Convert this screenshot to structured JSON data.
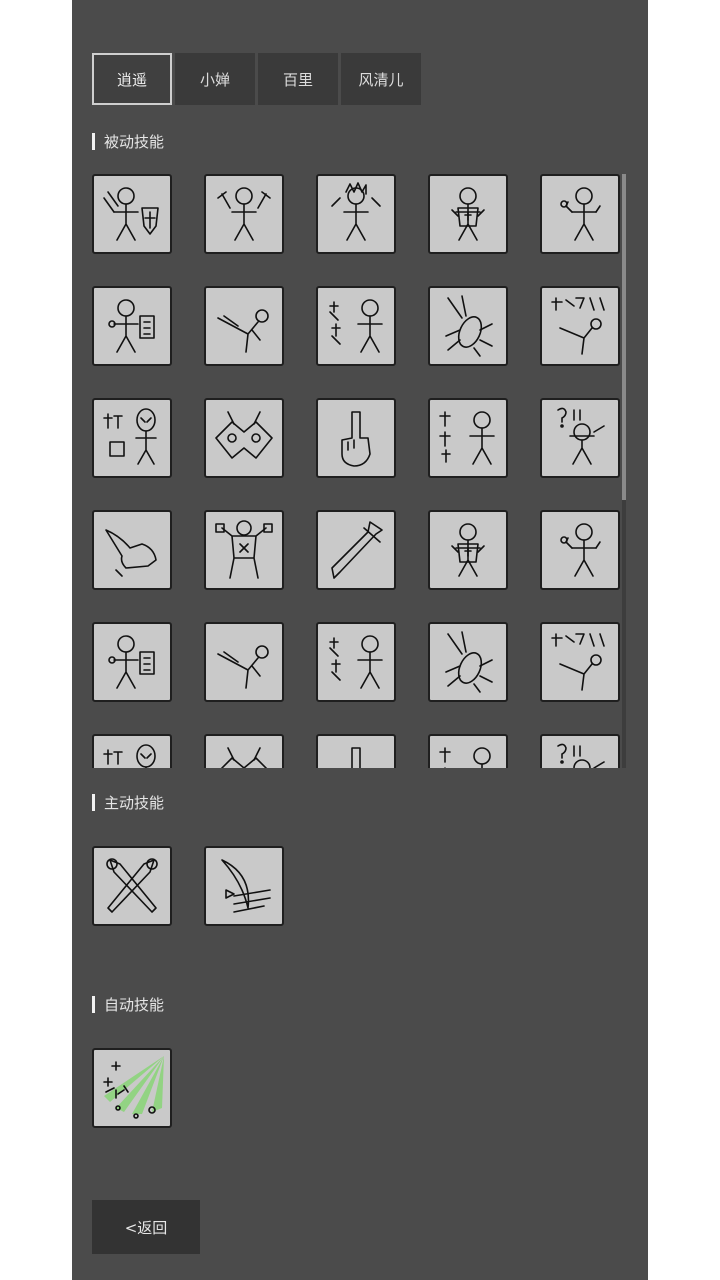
{
  "tabs": [
    {
      "label": "逍遥",
      "active": true
    },
    {
      "label": "小婵",
      "active": false
    },
    {
      "label": "百里",
      "active": false
    },
    {
      "label": "风清儿",
      "active": false
    }
  ],
  "sections": {
    "passive": {
      "title": "被动技能",
      "skills": [
        "knight-with-shield",
        "warrior-with-axes",
        "spiky-hair-brawler",
        "armored-figure",
        "stickman-flexing",
        "stickman-holding-card",
        "flying-kick",
        "shout-text-stickman",
        "cockroach",
        "come-here-kick",
        "hit-alien",
        "owl-mask",
        "middle-finger",
        "cheer-text-stickman",
        "question-marks-stickman",
        "foot-stomp",
        "bodybuilder",
        "broad-sword",
        "armored-figure",
        "stickman-flexing",
        "stickman-holding-card",
        "flying-kick",
        "shout-text-stickman",
        "cockroach",
        "come-here-kick",
        "hit-alien",
        "owl-mask",
        "middle-finger",
        "cheer-text-stickman",
        "question-marks-stickman"
      ]
    },
    "active": {
      "title": "主动技能",
      "skills": [
        "crossed-swords",
        "blade-slash"
      ]
    },
    "auto": {
      "title": "自动技能",
      "skills": [
        "hp-heal-rays"
      ]
    }
  },
  "back_button": "<返回",
  "colors": {
    "panel": "#4b4b4b",
    "tile": "#c9c9c9",
    "tab": "#3a3a3a",
    "heal_rays": "#7fd66b"
  }
}
